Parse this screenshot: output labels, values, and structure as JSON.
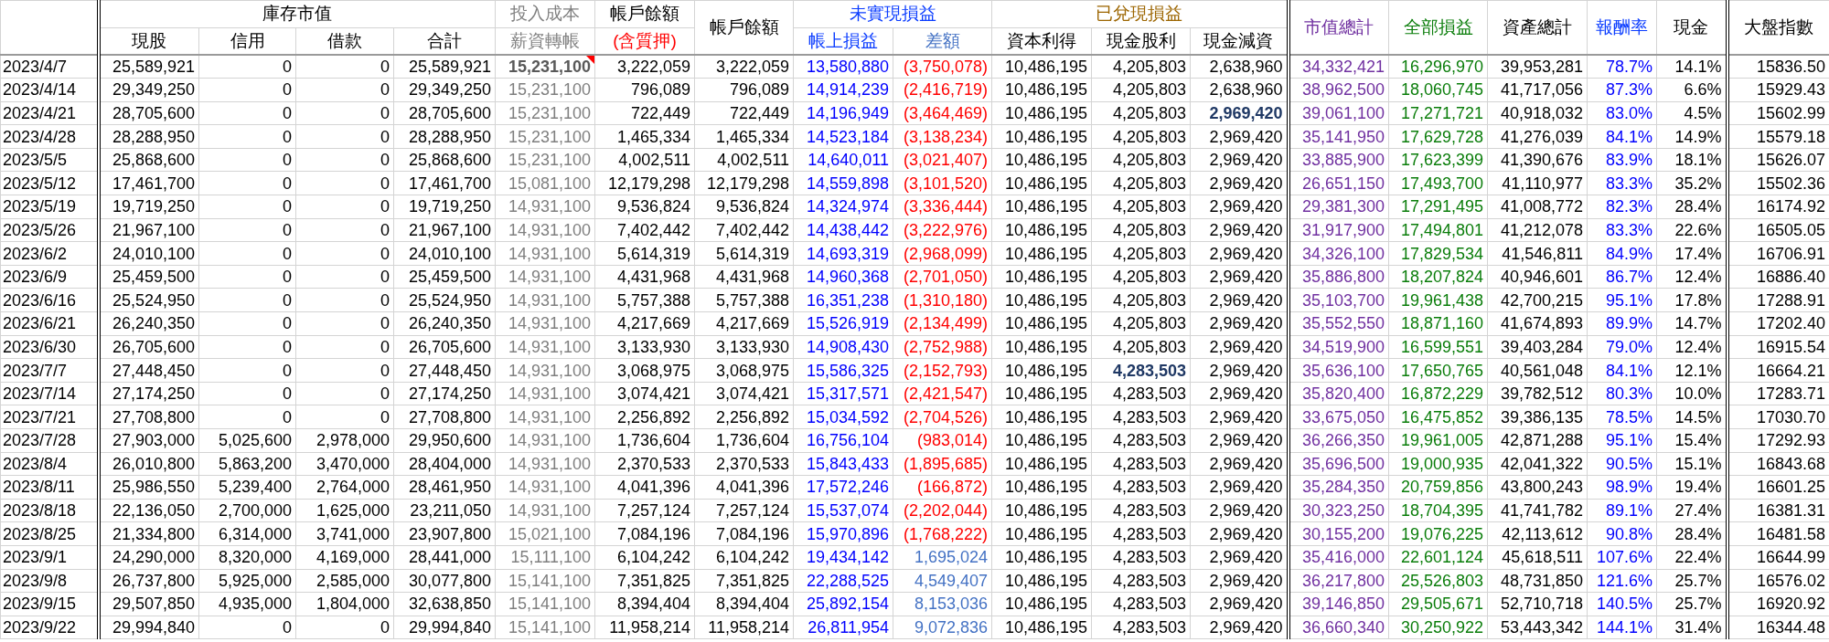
{
  "header_groups": [
    {
      "label": "庫存市值",
      "columns": [
        {
          "label": "現股"
        },
        {
          "label": "信用"
        },
        {
          "label": "借款"
        },
        {
          "label": "合計"
        }
      ]
    },
    {
      "label": "投入成本",
      "columns": [
        {
          "label": "薪資轉帳"
        }
      ]
    },
    {
      "label": "帳戶餘額",
      "columns": [
        {
          "label": "(含質押)"
        }
      ]
    },
    {
      "columns": [
        {
          "label": "帳戶餘額"
        }
      ]
    },
    {
      "label": "未實現損益",
      "columns": [
        {
          "label": "帳上損益"
        },
        {
          "label": "差額"
        }
      ]
    },
    {
      "label": "已兌現損益",
      "columns": [
        {
          "label": "資本利得"
        },
        {
          "label": "現金股利"
        },
        {
          "label": "現金減資"
        }
      ]
    },
    {
      "columns": [
        {
          "label": "市值總計"
        }
      ]
    },
    {
      "columns": [
        {
          "label": "全部損益"
        }
      ]
    },
    {
      "columns": [
        {
          "label": "資產總計"
        }
      ]
    },
    {
      "columns": [
        {
          "label": "報酬率"
        }
      ]
    },
    {
      "columns": [
        {
          "label": "現金"
        }
      ]
    },
    {
      "columns": [
        {
          "label": "大盤指數"
        }
      ]
    }
  ],
  "rows": [
    {
      "date": "2023/4/7",
      "unrealized_loss": true,
      "cells": [
        "25,589,921",
        "0",
        "0",
        "25,589,921",
        {
          "text": "15,231,100",
          "bold": true,
          "comment": true
        },
        "3,222,059",
        "3,222,059",
        "13,580,880",
        "(3,750,078)",
        "10,486,195",
        "4,205,803",
        "2,638,960",
        "34,332,421",
        "16,296,970",
        "39,953,281",
        "78.7%",
        "14.1%",
        "15836.50"
      ]
    },
    {
      "date": "2023/4/14",
      "unrealized_loss": true,
      "cells": [
        "29,349,250",
        "0",
        "0",
        "29,349,250",
        "15,231,100",
        "796,089",
        "796,089",
        "14,914,239",
        "(2,416,719)",
        "10,486,195",
        "4,205,803",
        "2,638,960",
        "38,962,500",
        "18,060,745",
        "41,717,056",
        "87.3%",
        "6.6%",
        "15929.43"
      ]
    },
    {
      "date": "2023/4/21",
      "unrealized_loss": true,
      "cells": [
        "28,705,600",
        "0",
        "0",
        "28,705,600",
        "15,231,100",
        "722,449",
        "722,449",
        "14,196,949",
        "(3,464,469)",
        "10,486,195",
        "4,205,803",
        {
          "text": "2,969,420",
          "bold": true
        },
        "39,061,100",
        "17,271,721",
        "40,918,032",
        "83.0%",
        "4.5%",
        "15602.99"
      ]
    },
    {
      "date": "2023/4/28",
      "unrealized_loss": true,
      "cells": [
        "28,288,950",
        "0",
        "0",
        "28,288,950",
        "15,231,100",
        "1,465,334",
        "1,465,334",
        "14,523,184",
        "(3,138,234)",
        "10,486,195",
        "4,205,803",
        "2,969,420",
        "35,141,950",
        "17,629,728",
        "41,276,039",
        "84.1%",
        "14.9%",
        "15579.18"
      ]
    },
    {
      "date": "2023/5/5",
      "unrealized_loss": true,
      "cells": [
        "25,868,600",
        "0",
        "0",
        "25,868,600",
        "15,231,100",
        "4,002,511",
        "4,002,511",
        "14,640,011",
        "(3,021,407)",
        "10,486,195",
        "4,205,803",
        "2,969,420",
        "33,885,900",
        "17,623,399",
        "41,390,676",
        "83.9%",
        "18.1%",
        "15626.07"
      ]
    },
    {
      "date": "2023/5/12",
      "unrealized_loss": true,
      "cells": [
        "17,461,700",
        "0",
        "0",
        "17,461,700",
        "15,081,100",
        "12,179,298",
        "12,179,298",
        "14,559,898",
        "(3,101,520)",
        "10,486,195",
        "4,205,803",
        "2,969,420",
        "26,651,150",
        "17,493,700",
        "41,110,977",
        "83.3%",
        "35.2%",
        "15502.36"
      ]
    },
    {
      "date": "2023/5/19",
      "unrealized_loss": true,
      "cells": [
        "19,719,250",
        "0",
        "0",
        "19,719,250",
        "14,931,100",
        "9,536,824",
        "9,536,824",
        "14,324,974",
        "(3,336,444)",
        "10,486,195",
        "4,205,803",
        "2,969,420",
        "29,381,300",
        "17,291,495",
        "41,008,772",
        "82.3%",
        "28.4%",
        "16174.92"
      ]
    },
    {
      "date": "2023/5/26",
      "unrealized_loss": true,
      "cells": [
        "21,967,100",
        "0",
        "0",
        "21,967,100",
        "14,931,100",
        "7,402,442",
        "7,402,442",
        "14,438,442",
        "(3,222,976)",
        "10,486,195",
        "4,205,803",
        "2,969,420",
        "31,917,900",
        "17,494,801",
        "41,212,078",
        "83.3%",
        "22.6%",
        "16505.05"
      ]
    },
    {
      "date": "2023/6/2",
      "unrealized_loss": true,
      "cells": [
        "24,010,100",
        "0",
        "0",
        "24,010,100",
        "14,931,100",
        "5,614,319",
        "5,614,319",
        "14,693,319",
        "(2,968,099)",
        "10,486,195",
        "4,205,803",
        "2,969,420",
        "34,326,100",
        "17,829,534",
        "41,546,811",
        "84.9%",
        "17.4%",
        "16706.91"
      ]
    },
    {
      "date": "2023/6/9",
      "unrealized_loss": true,
      "cells": [
        "25,459,500",
        "0",
        "0",
        "25,459,500",
        "14,931,100",
        "4,431,968",
        "4,431,968",
        "14,960,368",
        "(2,701,050)",
        "10,486,195",
        "4,205,803",
        "2,969,420",
        "35,886,800",
        "18,207,824",
        "40,946,601",
        "86.7%",
        "12.4%",
        "16886.40"
      ]
    },
    {
      "date": "2023/6/16",
      "unrealized_loss": true,
      "cells": [
        "25,524,950",
        "0",
        "0",
        "25,524,950",
        "14,931,100",
        "5,757,388",
        "5,757,388",
        "16,351,238",
        "(1,310,180)",
        "10,486,195",
        "4,205,803",
        "2,969,420",
        "35,103,700",
        "19,961,438",
        "42,700,215",
        "95.1%",
        "17.8%",
        "17288.91"
      ]
    },
    {
      "date": "2023/6/21",
      "unrealized_loss": true,
      "cells": [
        "26,240,350",
        "0",
        "0",
        "26,240,350",
        "14,931,100",
        "4,217,669",
        "4,217,669",
        "15,526,919",
        "(2,134,499)",
        "10,486,195",
        "4,205,803",
        "2,969,420",
        "35,552,550",
        "18,871,160",
        "41,674,893",
        "89.9%",
        "14.7%",
        "17202.40"
      ]
    },
    {
      "date": "2023/6/30",
      "unrealized_loss": true,
      "cells": [
        "26,705,600",
        "0",
        "0",
        "26,705,600",
        "14,931,100",
        "3,133,930",
        "3,133,930",
        "14,908,430",
        "(2,752,988)",
        "10,486,195",
        "4,205,803",
        "2,969,420",
        "34,519,900",
        "16,599,551",
        "39,403,284",
        "79.0%",
        "12.4%",
        "16915.54"
      ]
    },
    {
      "date": "2023/7/7",
      "unrealized_loss": true,
      "cells": [
        "27,448,450",
        "0",
        "0",
        "27,448,450",
        "14,931,100",
        "3,068,975",
        "3,068,975",
        "15,586,325",
        "(2,152,793)",
        "10,486,195",
        {
          "text": "4,283,503",
          "bold": true
        },
        "2,969,420",
        "35,636,100",
        "17,650,765",
        "40,561,048",
        "84.1%",
        "12.1%",
        "16664.21"
      ]
    },
    {
      "date": "2023/7/14",
      "unrealized_loss": true,
      "cells": [
        "27,174,250",
        "0",
        "0",
        "27,174,250",
        "14,931,100",
        "3,074,421",
        "3,074,421",
        "15,317,571",
        "(2,421,547)",
        "10,486,195",
        "4,283,503",
        "2,969,420",
        "35,820,400",
        "16,872,229",
        "39,782,512",
        "80.3%",
        "10.0%",
        "17283.71"
      ]
    },
    {
      "date": "2023/7/21",
      "unrealized_loss": true,
      "cells": [
        "27,708,800",
        "0",
        "0",
        "27,708,800",
        "14,931,100",
        "2,256,892",
        "2,256,892",
        "15,034,592",
        "(2,704,526)",
        "10,486,195",
        "4,283,503",
        "2,969,420",
        "33,675,050",
        "16,475,852",
        "39,386,135",
        "78.5%",
        "14.5%",
        "17030.70"
      ]
    },
    {
      "date": "2023/7/28",
      "unrealized_loss": true,
      "cells": [
        "27,903,000",
        "5,025,600",
        "2,978,000",
        "29,950,600",
        "14,931,100",
        "1,736,604",
        "1,736,604",
        "16,756,104",
        "(983,014)",
        "10,486,195",
        "4,283,503",
        "2,969,420",
        "36,266,350",
        "19,961,005",
        "42,871,288",
        "95.1%",
        "15.4%",
        "17292.93"
      ]
    },
    {
      "date": "2023/8/4",
      "unrealized_loss": true,
      "cells": [
        "26,010,800",
        "5,863,200",
        "3,470,000",
        "28,404,000",
        "14,931,100",
        "2,370,533",
        "2,370,533",
        "15,843,433",
        "(1,895,685)",
        "10,486,195",
        "4,283,503",
        "2,969,420",
        "35,696,500",
        "19,000,935",
        "42,041,322",
        "90.5%",
        "15.1%",
        "16843.68"
      ]
    },
    {
      "date": "2023/8/11",
      "unrealized_loss": true,
      "cells": [
        "25,986,550",
        "5,239,400",
        "2,764,000",
        "28,461,950",
        "14,931,100",
        "4,041,396",
        "4,041,396",
        "17,572,246",
        "(166,872)",
        "10,486,195",
        "4,283,503",
        "2,969,420",
        "35,284,350",
        "20,759,856",
        "43,800,243",
        "98.9%",
        "19.4%",
        "16601.25"
      ]
    },
    {
      "date": "2023/8/18",
      "unrealized_loss": true,
      "cells": [
        "22,136,050",
        "2,700,000",
        "1,625,000",
        "23,211,050",
        "14,931,100",
        "7,257,124",
        "7,257,124",
        "15,537,074",
        "(2,202,044)",
        "10,486,195",
        "4,283,503",
        "2,969,420",
        "30,323,250",
        "18,704,395",
        "41,741,782",
        "89.1%",
        "27.4%",
        "16381.31"
      ]
    },
    {
      "date": "2023/8/25",
      "unrealized_loss": true,
      "cells": [
        "21,334,800",
        "6,314,000",
        "3,741,000",
        "23,907,800",
        "15,021,100",
        "7,084,196",
        "7,084,196",
        "15,970,896",
        "(1,768,222)",
        "10,486,195",
        "4,283,503",
        "2,969,420",
        "30,155,200",
        "19,076,225",
        "42,113,612",
        "90.8%",
        "28.4%",
        "16481.58"
      ]
    },
    {
      "date": "2023/9/1",
      "unrealized_loss": false,
      "cells": [
        "24,290,000",
        "8,320,000",
        "4,169,000",
        "28,441,000",
        "15,111,100",
        "6,104,242",
        "6,104,242",
        "19,434,142",
        "1,695,024",
        "10,486,195",
        "4,283,503",
        "2,969,420",
        "35,416,000",
        "22,601,124",
        "45,618,511",
        "107.6%",
        "22.4%",
        "16644.99"
      ]
    },
    {
      "date": "2023/9/8",
      "unrealized_loss": false,
      "cells": [
        "26,737,800",
        "5,925,000",
        "2,585,000",
        "30,077,800",
        "15,141,100",
        "7,351,825",
        "7,351,825",
        "22,288,525",
        "4,549,407",
        "10,486,195",
        "4,283,503",
        "2,969,420",
        "36,217,800",
        "25,526,803",
        "48,731,850",
        "121.6%",
        "25.7%",
        "16576.02"
      ]
    },
    {
      "date": "2023/9/15",
      "unrealized_loss": false,
      "cells": [
        "29,507,850",
        "4,935,000",
        "1,804,000",
        "32,638,850",
        "15,141,100",
        "8,394,404",
        "8,394,404",
        "25,892,154",
        "8,153,036",
        "10,486,195",
        "4,283,503",
        "2,969,420",
        "39,146,850",
        "29,505,671",
        "52,710,718",
        "140.5%",
        "25.7%",
        "16920.92"
      ]
    },
    {
      "date": "2023/9/22",
      "unrealized_loss": false,
      "cells": [
        "29,994,840",
        "0",
        "0",
        "29,994,840",
        "15,141,100",
        "11,958,214",
        "11,958,214",
        "26,811,954",
        "9,072,836",
        "10,486,195",
        "4,283,503",
        "2,969,420",
        "36,660,340",
        "30,250,922",
        "53,443,342",
        "144.1%",
        "31.4%",
        "16344.48"
      ]
    }
  ]
}
